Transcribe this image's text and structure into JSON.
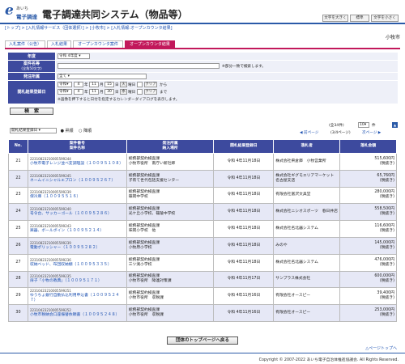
{
  "header": {
    "logo_mark": "e",
    "logo_line1": "あいち",
    "logo_line2": "電子調達",
    "title": "電子調達共同システム（物品等）",
    "size_large": "文字を大きく",
    "size_normal": "標準",
    "size_small": "文字を小さく"
  },
  "breadcrumb": "[トップ] > [入札情報サービス（団体選択）] > [小牧市] > [入札情報:オープンカウンタ結果]",
  "org_name": "小牧市",
  "tabs": [
    "入札案件（公告）",
    "入札結果",
    "オープンカウンタ案件",
    "オープンカウンタ結果"
  ],
  "form": {
    "year_label": "年度",
    "year_value": "令和 4年度",
    "name_label": "案件名等",
    "name_sub": "(全角50文字)",
    "name_note": "※部分一致で検索します。",
    "dept_label": "発注所属",
    "dept_value": "全て",
    "date_label": "開札結果登録日",
    "from": {
      "era": "令和",
      "y": "4",
      "m": "11",
      "d": "15",
      "dow": "火"
    },
    "to": {
      "era": "令和",
      "y": "4",
      "m": "11",
      "d": "30",
      "dow": "水"
    },
    "clear_label": "クリア",
    "from_suffix": "から",
    "to_suffix": "まで",
    "cal_note": "※画像を押下すると日付を指定するカレンダーダイアログを表示します。",
    "unit_year": "年",
    "unit_month": "月",
    "unit_day": "日",
    "unit_weekday": "曜日",
    "search_label": "検　索"
  },
  "sort": {
    "value": "開札結果登録日",
    "asc": "昇順",
    "desc": "降順"
  },
  "pager": {
    "total": "(全34件)",
    "per_page": "10",
    "per_label": "件",
    "page_info": "(3/4ページ)",
    "prev": "前ページ",
    "next": "次ページ"
  },
  "table": {
    "headers": {
      "no": "No.",
      "num": "案件番号",
      "name": "案件名称",
      "dept": "発注所属",
      "place": "納入場所",
      "date": "開札結果登録日",
      "company": "落札者",
      "amount": "落札金額"
    },
    "rows": [
      {
        "no": "21",
        "num": "22310823210005599244",
        "name": "小牧市電子レンジ並べ変調理設（１００９５１０８）",
        "dept": "総務部契約検査課",
        "place": "小牧市役所　南庁い新社師",
        "date": "令和 4年11月18日",
        "company": "株式会社県倉庫　小牧営業所",
        "amount": "515,600円",
        "tax": "(税抜き)"
      },
      {
        "no": "22",
        "num": "22310823210005599245",
        "name": "ネームイニシャルエプロン（１００９５２６７）",
        "dept": "総務部契約検査課",
        "place": "子育て世代包括支援センター",
        "date": "令和 4年11月18日",
        "company": "株式会社ギグモエリアマーケット　名古屋支店",
        "amount": "65,760円",
        "tax": "(税抜き)"
      },
      {
        "no": "23",
        "num": "22310823210005599239",
        "name": "保冷庫（１００９５５１６）",
        "dept": "総務部契約検査課",
        "place": "篠岡中学校",
        "date": "令和 4年11月18日",
        "company": "有限会社富沢文具堂",
        "amount": "280,000円",
        "tax": "(税抜き)"
      },
      {
        "no": "24",
        "num": "22310823210005599240",
        "name": "号令台、サッカーゴール（１００９５２８６）",
        "dept": "総務部契約検査課",
        "place": "光ケ丘小学校、篠陵中学校",
        "date": "令和 4年11月18日",
        "company": "株式会社ニシオスポーツ　春日井店",
        "amount": "558,500円",
        "tax": "(税抜き)"
      },
      {
        "no": "25",
        "num": "22310823210005599243",
        "name": "楽器、ボールボイン（１００９５２１４）",
        "dept": "総務部契約検査課",
        "place": "味岡小学校　他",
        "date": "令和 4年11月18日",
        "company": "株式会社名北器システム",
        "amount": "116,600円",
        "tax": "(税抜き)"
      },
      {
        "no": "26",
        "num": "22310823210005599239",
        "name": "電動ポリッシャー（１００９５２８２）",
        "dept": "総務部契約検査課",
        "place": "小牧原小学校",
        "date": "令和 4年11月18日",
        "company": "みのや",
        "amount": "145,000円",
        "tax": "(税抜き)"
      },
      {
        "no": "27",
        "num": "22310823210005599236",
        "name": "収納ベッド、布団収納棚（１００９５３３５）",
        "dept": "総務部契約検査課",
        "place": "三ツ渕小学校",
        "date": "令和 4年11月18日",
        "company": "株式会社名北器システム",
        "amount": "476,000円",
        "tax": "(税抜き)"
      },
      {
        "no": "28",
        "num": "22310423210005599235",
        "name": "扉子「小牧の教典」（１００９５１７１）",
        "dept": "総務部契約検査課",
        "place": "小牧市役所　障連対策課",
        "date": "令和 4年11月17日",
        "company": "サンプラス株式会社",
        "amount": "600,000円",
        "tax": "(税抜き)"
      },
      {
        "no": "29",
        "num": "22310423210005599251",
        "name": "ゆうちょ銀行自動払込利用申込書（１００９５２４７）",
        "dept": "総務部契約検査課",
        "place": "小牧市役所　収税課",
        "date": "令和 4年11月16日",
        "company": "有限会社オースピー",
        "amount": "39,400円",
        "tax": "(税抜き)"
      },
      {
        "no": "30",
        "num": "22310423210005599252",
        "name": "小牧市税納会口座振替依頼書（１００９５２４８）",
        "dept": "総務部契約検査課",
        "place": "小牧市役所　収税課",
        "date": "令和 4年11月16日",
        "company": "有限会社オースピー",
        "amount": "253,000円",
        "tax": "(税抜き)"
      }
    ]
  },
  "back_button": "団体のトップページへ戻る",
  "page_top": "△ページトップへ",
  "copyright": "Copyright © 2007-2022 あいち電子自治体推進協議会. All Rights Reserved.",
  "colors": {
    "accent": "#2a5aa8",
    "tab_active": "#c2185b",
    "table_header": "#3d4a9e"
  }
}
